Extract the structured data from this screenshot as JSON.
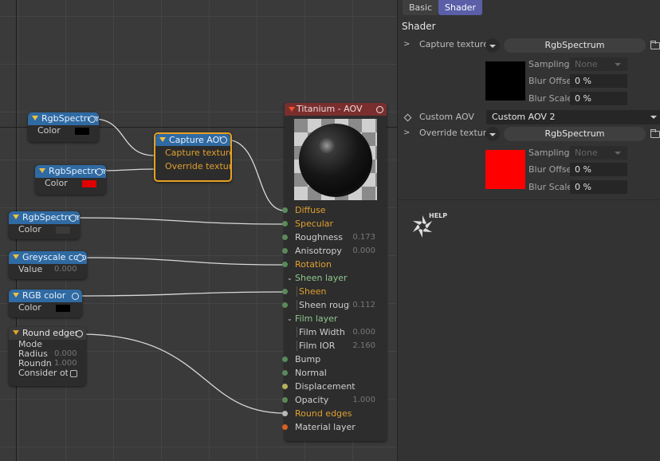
{
  "colors": {
    "accent": "#5a5fa8",
    "node_blue": "#2f6aa3",
    "node_material": "#7a2e2e",
    "port_orange": "#e0a030",
    "selected_border": "#e8a020",
    "capture_texture_color": "#000000",
    "override_texture_color": "#ff0000"
  },
  "nodes": {
    "rgb1": {
      "title": "RgbSpectrum",
      "row_label": "Color",
      "swatch": "#000000"
    },
    "rgb2": {
      "title": "RgbSpectrum",
      "row_label": "Color",
      "swatch": "#e00000"
    },
    "rgb3": {
      "title": "RgbSpectrum",
      "row_label": "Color",
      "swatch": "#3a3a3a"
    },
    "capture": {
      "title": "Capture AOV",
      "rows": [
        "Capture texture",
        "Override texture"
      ]
    },
    "greyscale": {
      "title": "Greyscale color",
      "row_label": "Value",
      "value": "0.000"
    },
    "rgbcolor": {
      "title": "RGB color",
      "row_label": "Color",
      "swatch": "#000000"
    },
    "round": {
      "title": "Round edges",
      "rows": [
        {
          "label": "Mode",
          "value": ""
        },
        {
          "label": "Radius",
          "value": "0.000"
        },
        {
          "label": "Roundness",
          "value": "1.000"
        },
        {
          "label": "Consider other",
          "value": ""
        }
      ]
    },
    "titanium": {
      "title": "Titanium - AOV",
      "ports": [
        {
          "label": "Diffuse",
          "value": ""
        },
        {
          "label": "Specular",
          "value": ""
        },
        {
          "label": "Roughness",
          "value": "0.173"
        },
        {
          "label": "Anisotropy",
          "value": "0.000"
        },
        {
          "label": "Rotation",
          "value": ""
        },
        {
          "label": "Sheen layer",
          "value": ""
        },
        {
          "label": "Sheen",
          "value": ""
        },
        {
          "label": "Sheen roughness",
          "value": "0.112"
        },
        {
          "label": "Film layer",
          "value": ""
        },
        {
          "label": "Film Width",
          "value": "0.000"
        },
        {
          "label": "Film IOR",
          "value": "2.160"
        },
        {
          "label": "Bump",
          "value": ""
        },
        {
          "label": "Normal",
          "value": ""
        },
        {
          "label": "Displacement",
          "value": ""
        },
        {
          "label": "Opacity",
          "value": "1.000"
        },
        {
          "label": "Round edges",
          "value": ""
        },
        {
          "label": "Material layer",
          "value": ""
        }
      ]
    }
  },
  "panel": {
    "tabs": [
      "Basic",
      "Shader"
    ],
    "section_title": "Shader",
    "capture_texture": {
      "label": "Capture texture",
      "button": "RgbSpectrum",
      "sampling_label": "Sampling",
      "sampling_value": "None",
      "blur_offset_label": "Blur Offset",
      "blur_offset": "0 %",
      "blur_scale_label": "Blur Scale",
      "blur_scale": "0 %"
    },
    "custom_aov": {
      "label": "Custom AOV",
      "value": "Custom AOV 2"
    },
    "override_texture": {
      "label": "Override texture",
      "button": "RgbSpectrum",
      "sampling_label": "Sampling",
      "sampling_value": "None",
      "blur_offset_label": "Blur Offset",
      "blur_offset": "0 %",
      "blur_scale_label": "Blur Scale",
      "blur_scale": "0 %"
    },
    "help_label": "HELP"
  }
}
